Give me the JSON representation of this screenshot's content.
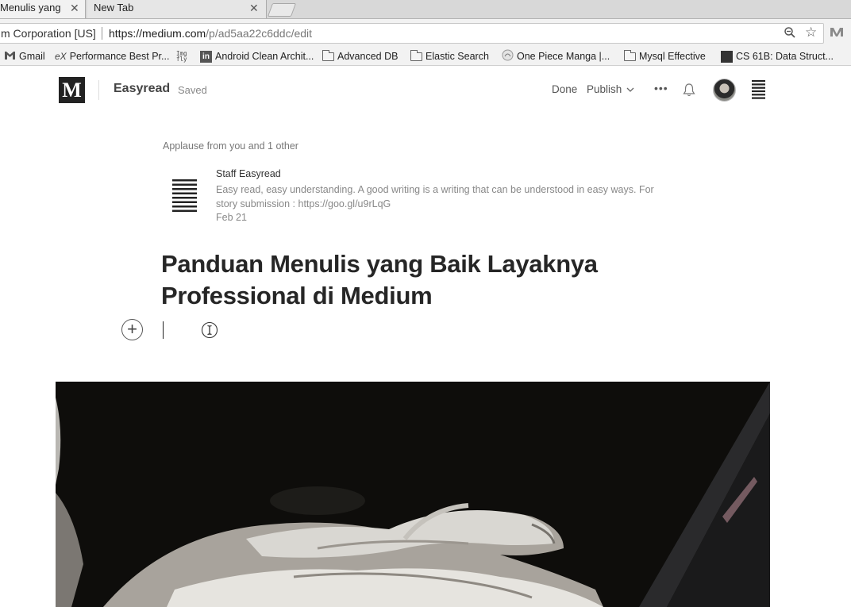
{
  "browser": {
    "tabs": [
      {
        "title": "Menulis yang",
        "active": true
      },
      {
        "title": "New Tab",
        "active": false
      }
    ],
    "omnibox": {
      "site_identity": "m Corporation [US]",
      "url_domain": "https://medium.com",
      "url_path": "/p/ad5aa22c6ddc/edit"
    },
    "bookmarks": [
      {
        "label": "Gmail",
        "icon": "gmail-icon"
      },
      {
        "label": "Performance Best Pr...",
        "icon": "ex-icon"
      },
      {
        "label": "",
        "icon": "imgur-icon"
      },
      {
        "label": "Android Clean Archit...",
        "icon": "linkedin-icon"
      },
      {
        "label": "Advanced DB",
        "icon": "folder-icon"
      },
      {
        "label": "Elastic Search",
        "icon": "folder-icon"
      },
      {
        "label": "One Piece Manga |...",
        "icon": "manga-icon"
      },
      {
        "label": "Mysql Effective",
        "icon": "folder-icon"
      },
      {
        "label": "CS 61B: Data Struct...",
        "icon": "cs61b-icon"
      }
    ],
    "logo_badge_text": "Img\nfly"
  },
  "editor_header": {
    "logo_letter": "M",
    "publication": "Easyread",
    "status": "Saved",
    "done_label": "Done",
    "publish_label": "Publish",
    "more_label": "•••"
  },
  "article": {
    "applause": "Applause from you and 1 other",
    "author": {
      "name": "Staff Easyread",
      "bio": "Easy read, easy understanding. A good writing is a writing that can be understood in easy ways. For story submission : https://goo.gl/u9rLqG",
      "date": "Feb 21"
    },
    "title": "Panduan Menulis yang Baik Layaknya Professional di Medium",
    "plus_label": "+"
  },
  "colors": {
    "title_text": "#262626",
    "muted_text": "#888888",
    "logo_bg": "#222222"
  }
}
